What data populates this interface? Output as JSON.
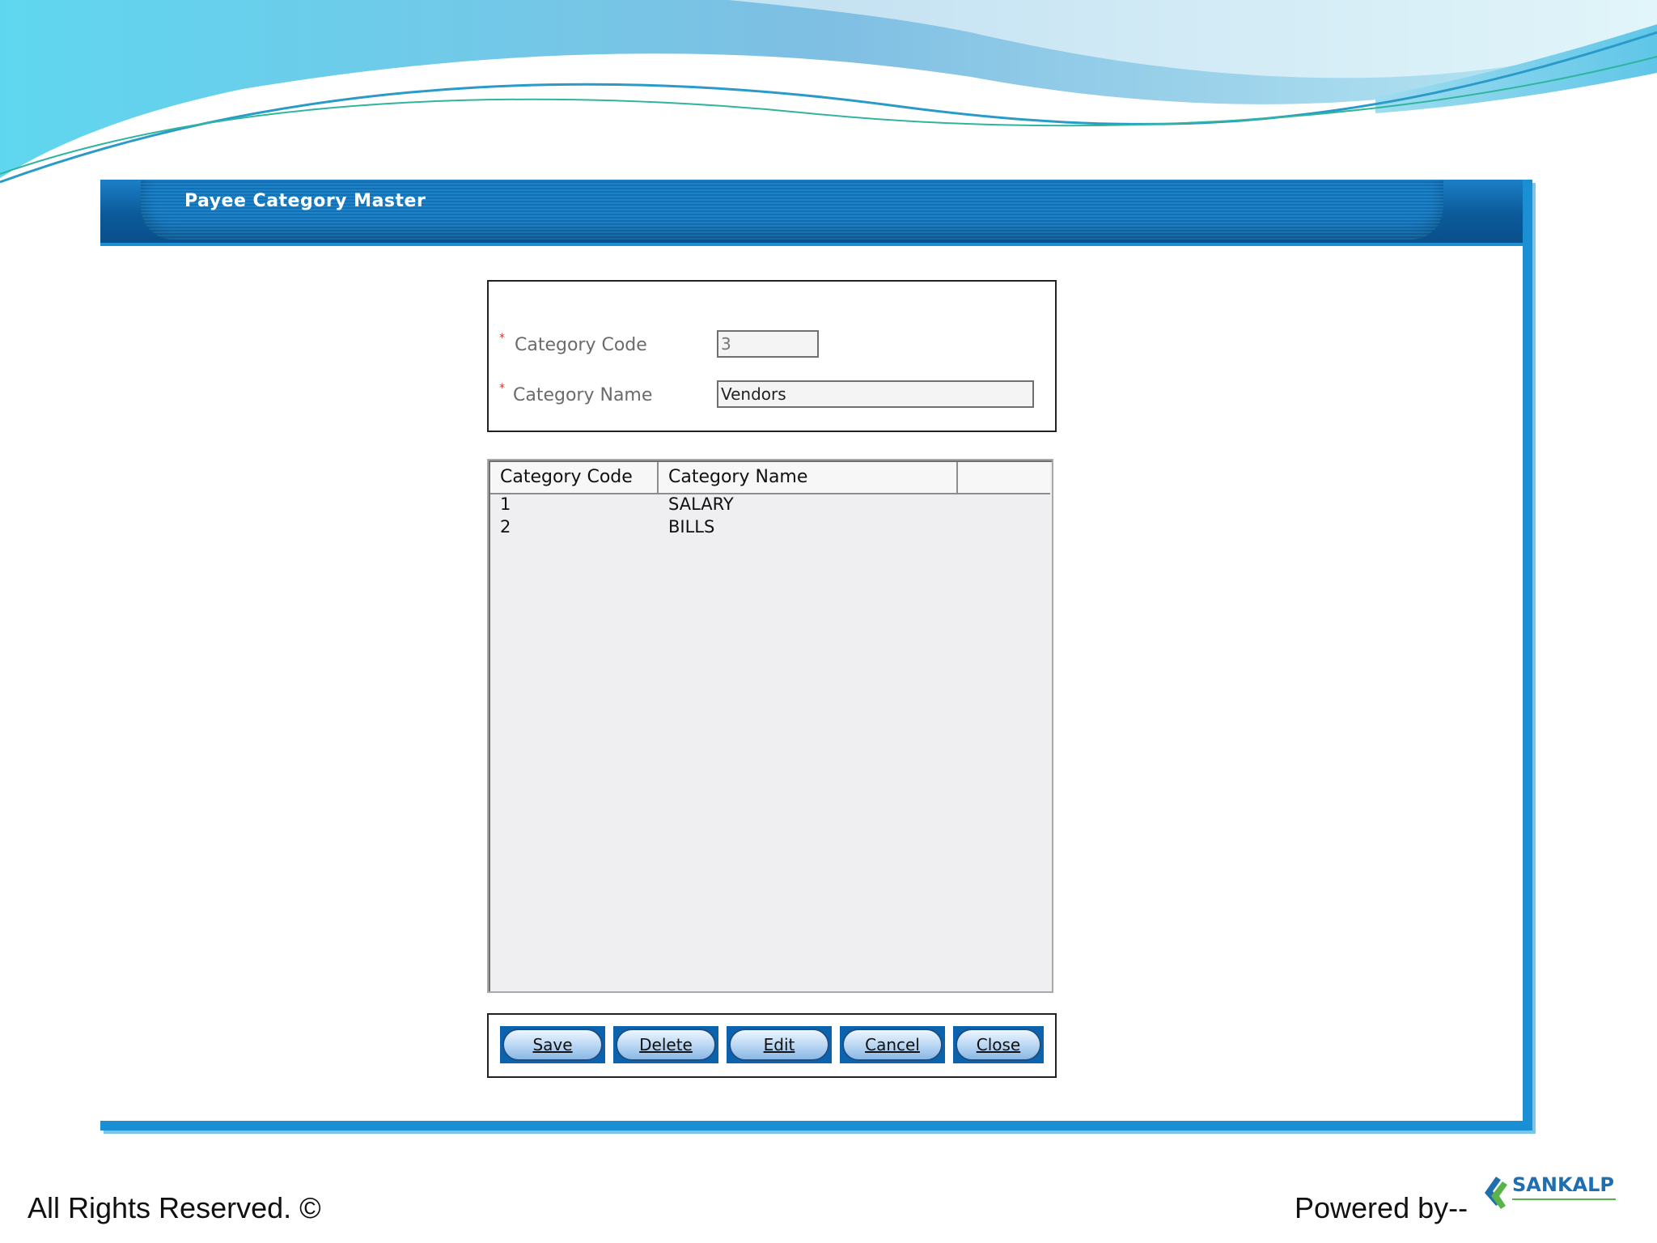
{
  "window": {
    "title": "Payee Category Master"
  },
  "form": {
    "required_mark": "*",
    "code_label": "Category Code",
    "code_value": "3",
    "name_label": "Category Name",
    "name_value": "Vendors"
  },
  "grid": {
    "columns": [
      "Category Code",
      "Category Name",
      ""
    ],
    "rows": [
      {
        "code": "1",
        "name": "SALARY"
      },
      {
        "code": "2",
        "name": "BILLS"
      }
    ]
  },
  "buttons": {
    "save": "Save",
    "delete": "Delete",
    "edit": "Edit",
    "cancel": "Cancel",
    "close": "Close"
  },
  "footer": {
    "rights": "All Rights Reserved. ©",
    "powered": "Powered by--",
    "logo_text": "SANKALP"
  },
  "colors": {
    "title_bar": "#0b5a9a",
    "accent": "#1a8fd4",
    "required": "#e03030",
    "button": "#0c63ad"
  }
}
